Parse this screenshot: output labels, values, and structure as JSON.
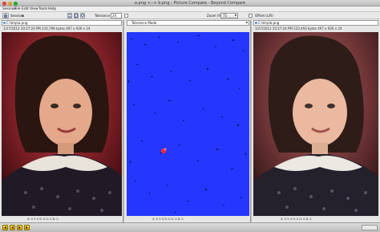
{
  "window": {
    "title": "a.png <--> b.png - Picture Compare - Beyond Compare"
  },
  "menu": [
    "Session",
    "File",
    "Edit",
    "View",
    "Tools",
    "Help"
  ],
  "toolbar": {
    "sessions_label": "Sessions",
    "tolerance_label": "Tolerance",
    "tolerance_value": "24",
    "zoom_label": "Zoom (%)",
    "zoom_value": "75",
    "offset_label": "Offset (L/R)"
  },
  "left": {
    "path": "C:\\tmp\\a.png",
    "info": "1/27/2012 10:27:24 PM    210,799 bytes    497 x 926 x 24",
    "status": "X: 0  Y: 0  R: 0  G: 0  B: 0"
  },
  "diff": {
    "mode": "Tolerance Mode",
    "status": "X: 0  Y: 0  R: 0  G: 0  B: 0"
  },
  "right": {
    "path": "C:\\tmp\\b.png",
    "info": "1/27/2012 10:27:24 PM    523,493 bytes    497 x 926 x 24",
    "status": "X: 0  Y: 0  R: 0  G: 0  B: 0"
  },
  "colors": {
    "diff_background": "#2536ff",
    "diff_highlight": "#ff2a2a"
  },
  "icons": [
    "home-icon",
    "swap-icon",
    "copy-icon",
    "zoom-icon",
    "offset-icon",
    "nav-prev-icon",
    "nav-next-icon"
  ]
}
